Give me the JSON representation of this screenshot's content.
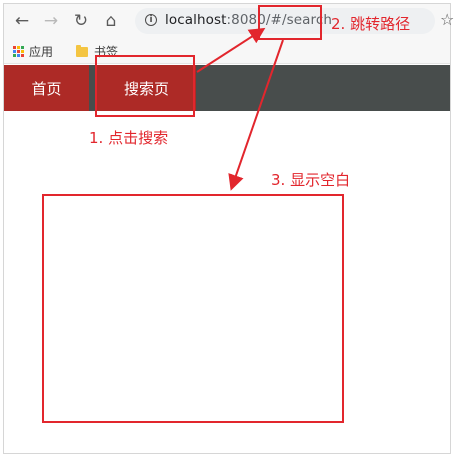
{
  "browser": {
    "url_host": "localhost",
    "url_rest": ":8080/#/search",
    "bookmarks": [
      {
        "label": "应用",
        "icon": "apps-grid-icon"
      },
      {
        "label": "书签",
        "icon": "folder-icon"
      }
    ]
  },
  "app_nav": {
    "items": [
      {
        "label": "首页"
      },
      {
        "label": "搜索页"
      }
    ]
  },
  "annotations": {
    "step1": "1. 点击搜索",
    "step2": "2. 跳转路径",
    "step3": "3. 显示空白"
  },
  "colors": {
    "annotation": "#e2262d",
    "nav_bar": "#484d4c",
    "nav_active": "#ad2a26"
  }
}
